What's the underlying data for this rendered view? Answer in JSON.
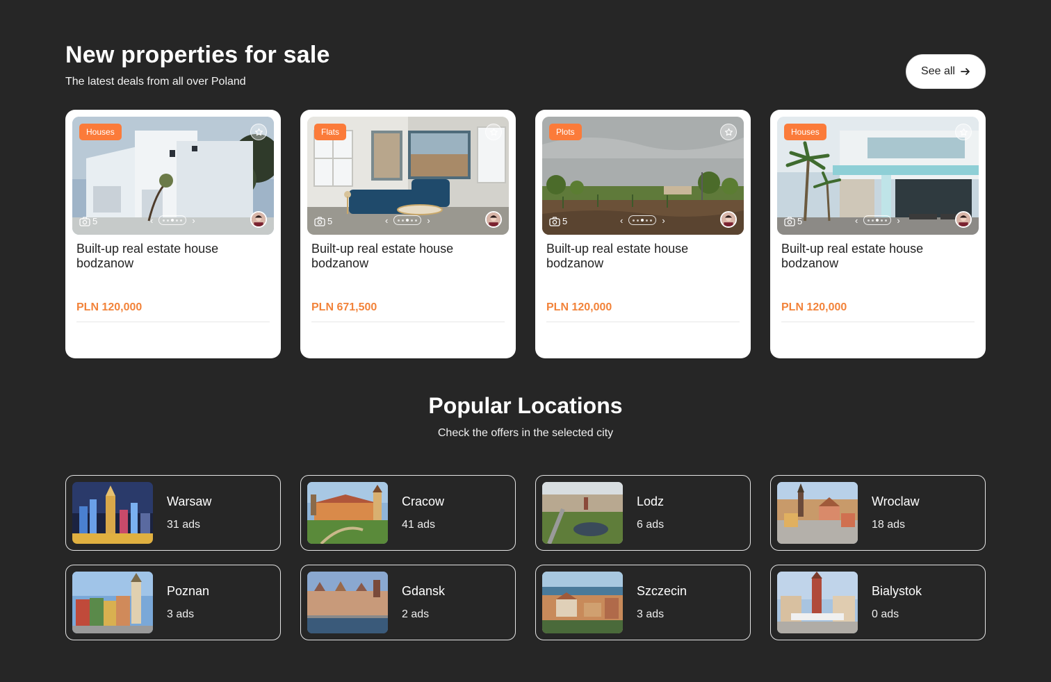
{
  "new_properties": {
    "title": "New properties for sale",
    "subtitle": "The latest deals from all over Poland",
    "see_all_label": "See all",
    "cards": [
      {
        "category": "Houses",
        "photo_count": "5",
        "title": "Built-up real estate house bodzanow",
        "price": "PLN 120,000",
        "scene": "modern-white-house"
      },
      {
        "category": "Flats",
        "photo_count": "5",
        "title": "Built-up real estate house bodzanow",
        "price": "PLN 671,500",
        "scene": "living-room"
      },
      {
        "category": "Plots",
        "photo_count": "5",
        "title": "Built-up real estate house bodzanow",
        "price": "PLN 120,000",
        "scene": "empty-plot"
      },
      {
        "category": "Houses",
        "photo_count": "5",
        "title": "Built-up real estate house bodzanow",
        "price": "PLN 120,000",
        "scene": "villa-with-palms"
      }
    ]
  },
  "popular_locations": {
    "title": "Popular Locations",
    "subtitle": "Check the offers in the selected city",
    "cities": [
      {
        "name": "Warsaw",
        "ads": "31 ads"
      },
      {
        "name": "Cracow",
        "ads": "41 ads"
      },
      {
        "name": "Lodz",
        "ads": "6 ads"
      },
      {
        "name": "Wroclaw",
        "ads": "18 ads"
      },
      {
        "name": "Poznan",
        "ads": "3 ads"
      },
      {
        "name": "Gdansk",
        "ads": "2 ads"
      },
      {
        "name": "Szczecin",
        "ads": "3 ads"
      },
      {
        "name": "Bialystok",
        "ads": "0 ads"
      }
    ]
  },
  "colors": {
    "background": "#262626",
    "accent": "#fb7b3a",
    "price": "#f2833a",
    "card": "#ffffff"
  },
  "icons": [
    "arrow-right-icon",
    "star-icon",
    "camera-icon",
    "chevron-left-icon",
    "chevron-right-icon"
  ]
}
